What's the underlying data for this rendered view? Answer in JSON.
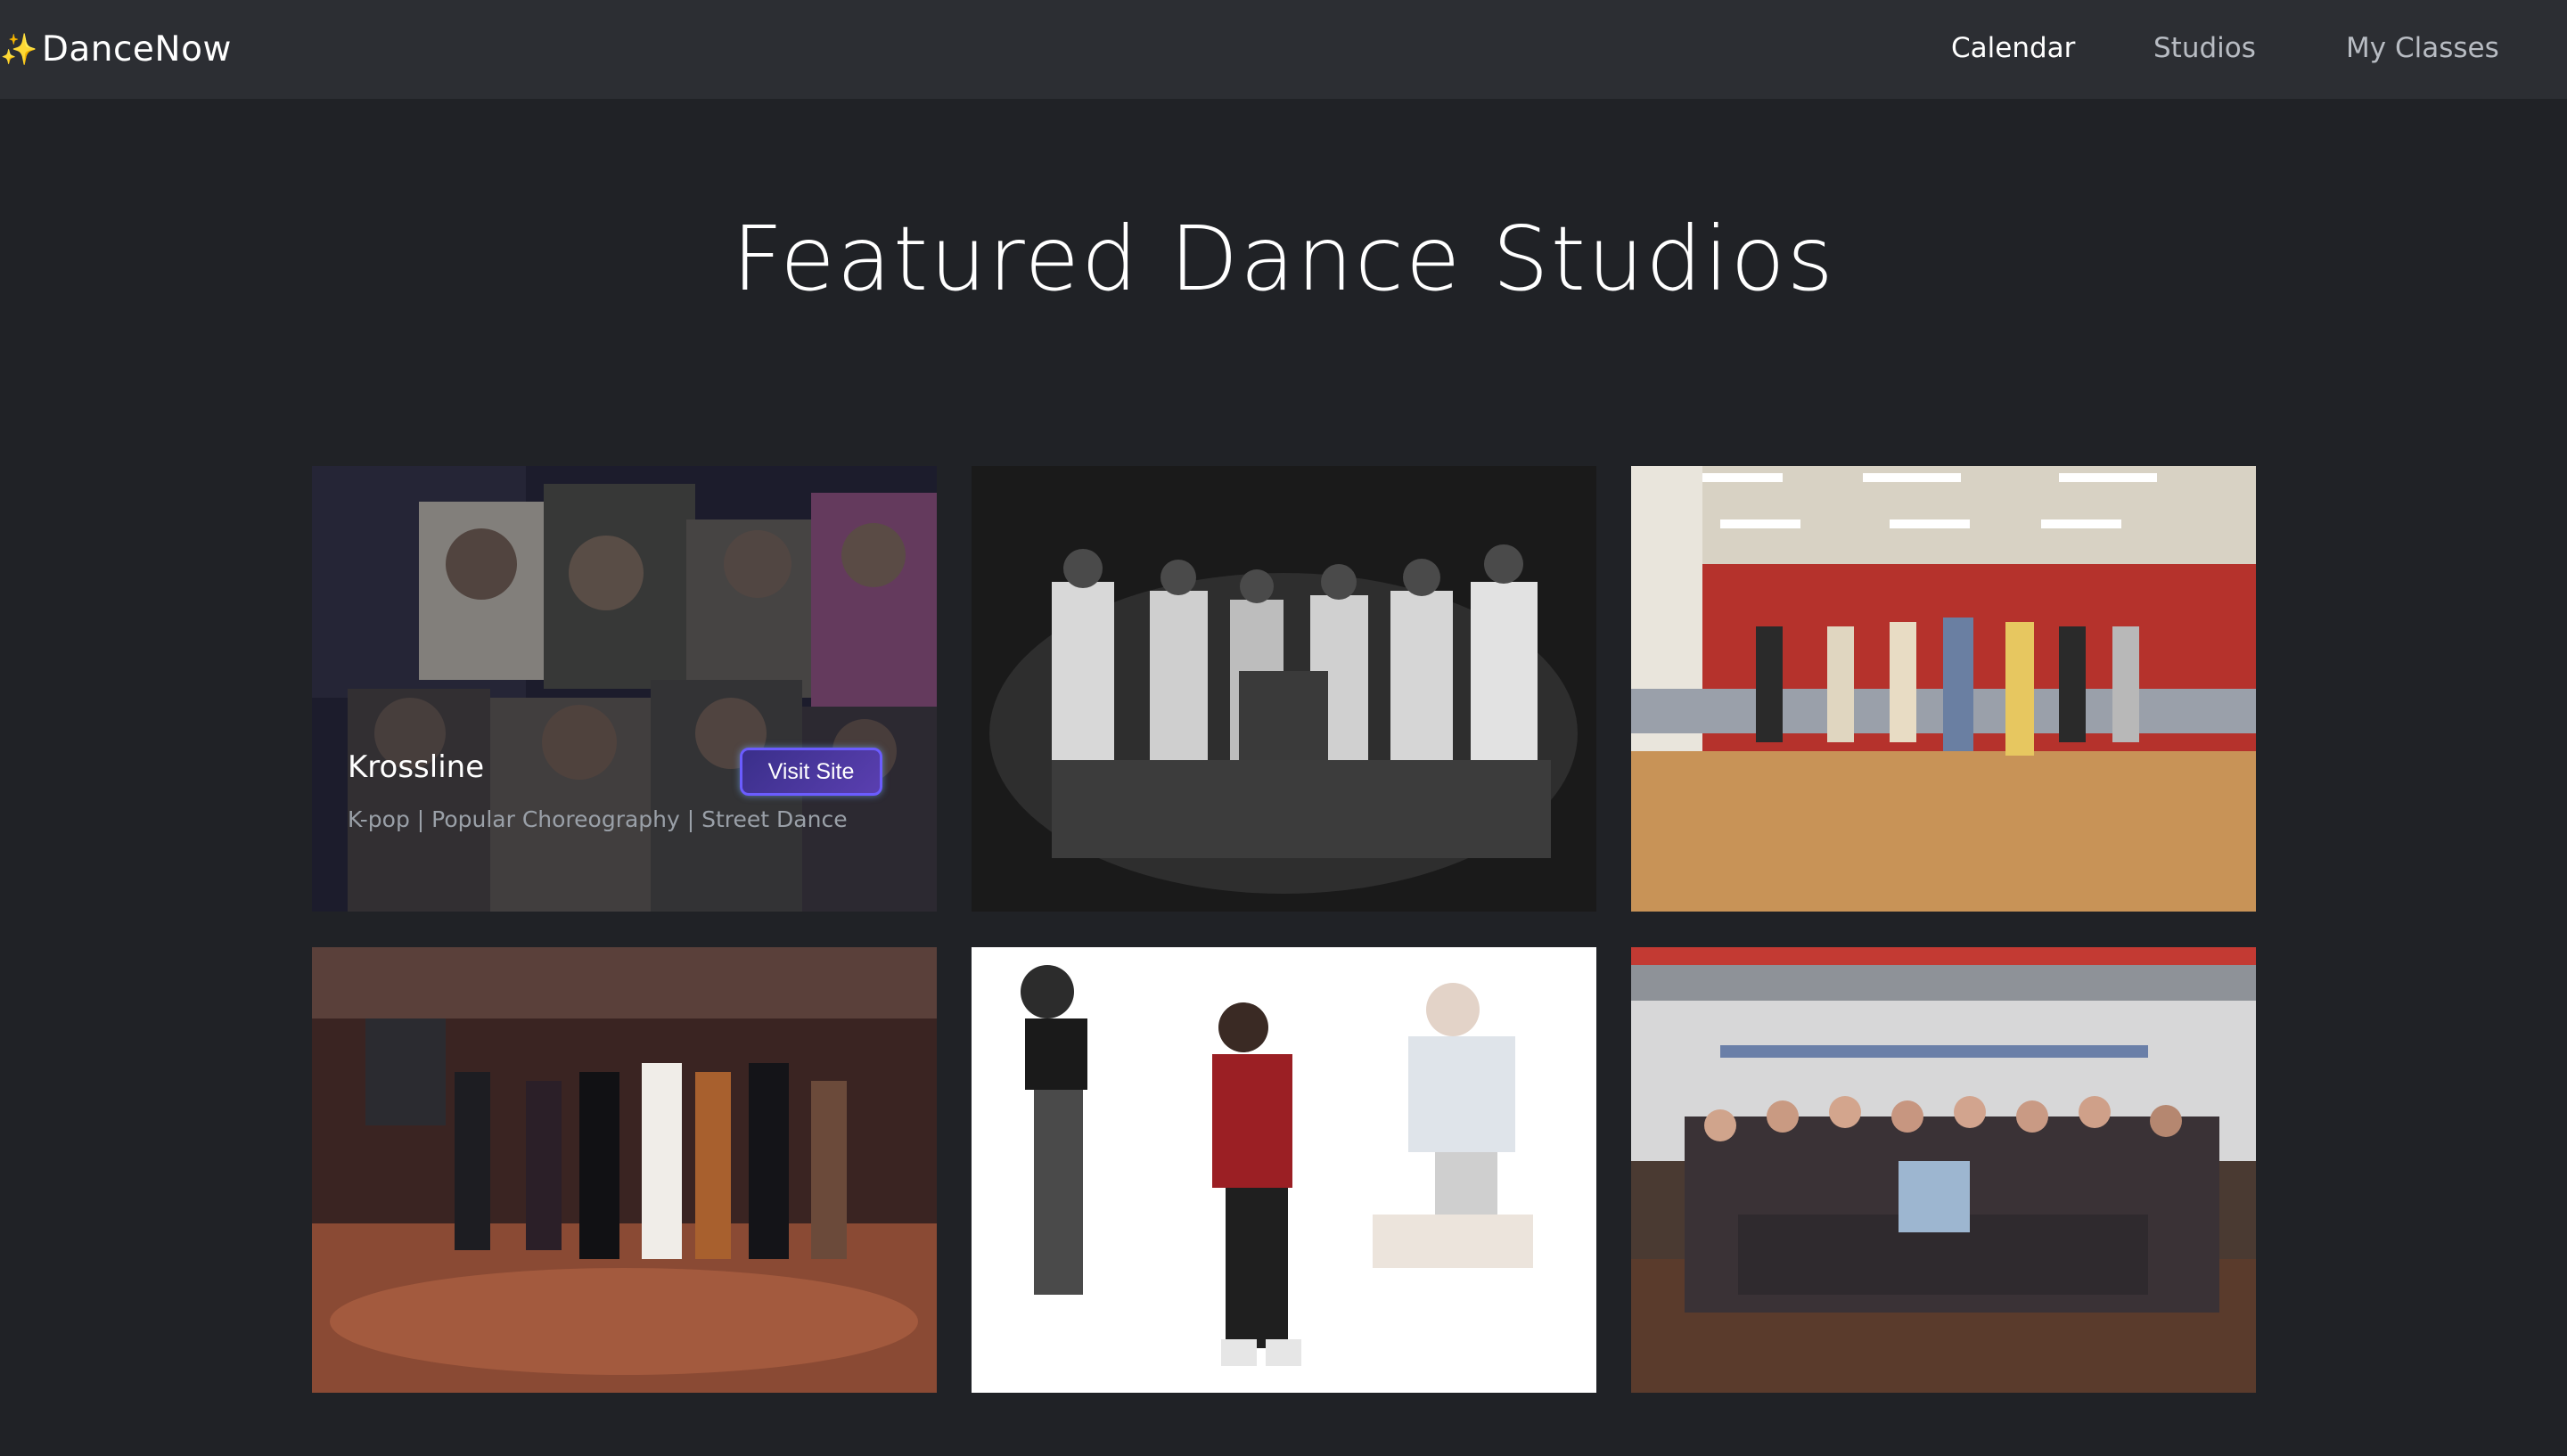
{
  "nav": {
    "brand_icon": "sparkles-icon",
    "brand_icon_glyph": "✨",
    "brand": "DanceNow",
    "links": [
      {
        "label": "Calendar",
        "active": true
      },
      {
        "label": "Studios",
        "active": false
      },
      {
        "label": "My Classes",
        "active": false
      }
    ]
  },
  "page": {
    "title": "Featured Dance Studios"
  },
  "studios": [
    {
      "name": "Krossline",
      "tags": "K-pop | Popular Choreography | Street Dance",
      "button": "Visit Site",
      "hovered": true
    },
    {
      "name": "",
      "tags": ""
    },
    {
      "name": "",
      "tags": ""
    },
    {
      "name": "",
      "tags": ""
    },
    {
      "name": "",
      "tags": ""
    },
    {
      "name": "",
      "tags": ""
    }
  ],
  "colors": {
    "background": "#202226",
    "navbar": "#2c2e33",
    "button_border": "#6b5cff"
  }
}
